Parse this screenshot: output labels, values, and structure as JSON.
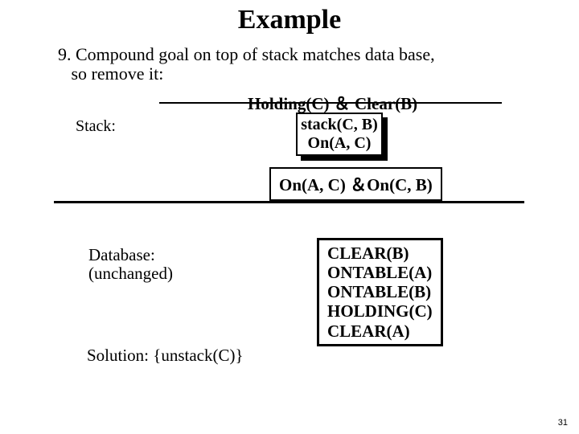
{
  "title": "Example",
  "step_number": "9.",
  "step_text_line1": "Compound goal on top of stack matches data base,",
  "step_text_line2": "so remove it:",
  "stack_label": "Stack:",
  "removed_goal": "Holding(C) ＆ Clear(B)",
  "stack_box_line1": "stack(C, B)",
  "stack_box_line2": "On(A, C)",
  "bottom_goal": "On(A, C) ＆On(C, B)",
  "database_label_line1": "Database:",
  "database_label_line2": " (unchanged)",
  "database_facts": [
    "CLEAR(B)",
    "ONTABLE(A)",
    "ONTABLE(B)",
    "HOLDING(C)",
    "CLEAR(A)"
  ],
  "solution_label": "Solution: {unstack(C)}",
  "page_number": "31"
}
